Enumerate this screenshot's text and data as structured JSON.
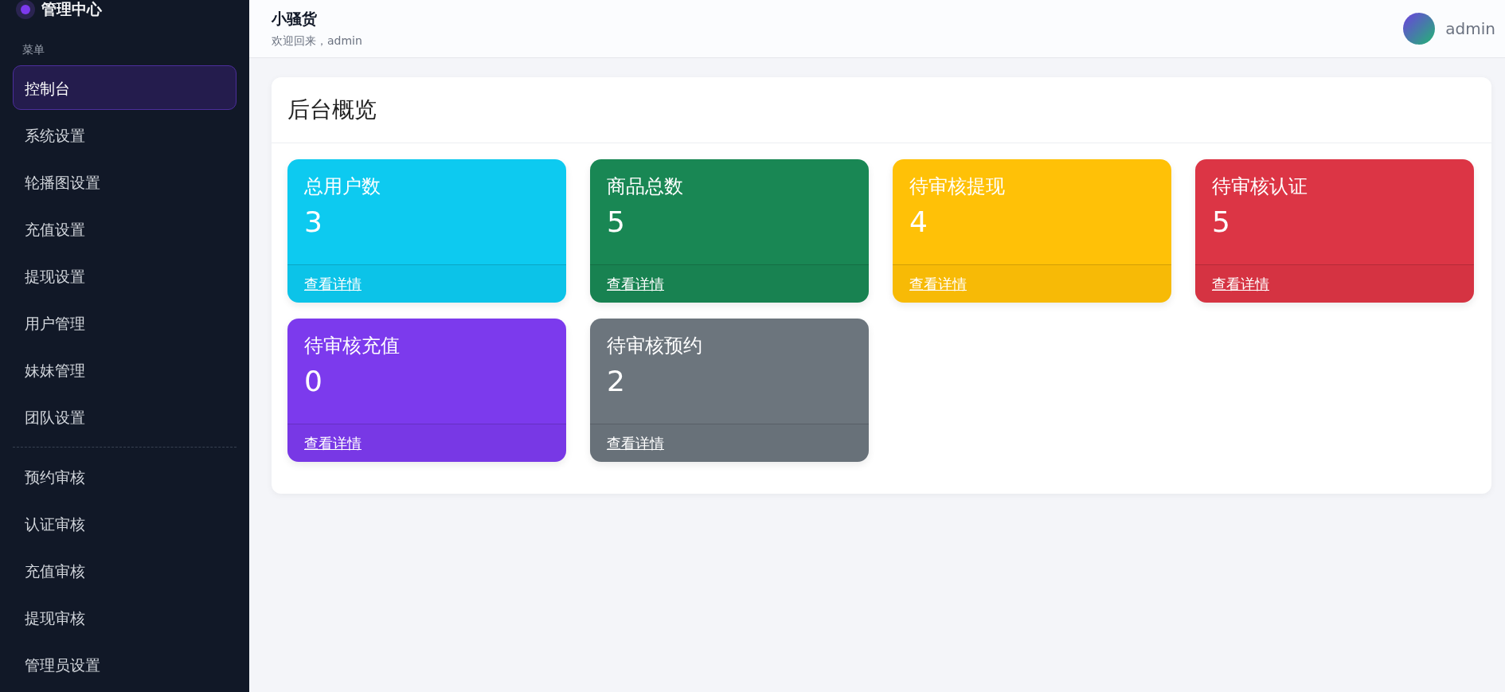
{
  "sidebar": {
    "brand": "管理中心",
    "section_label": "菜单",
    "groups": [
      [
        {
          "label": "控制台",
          "selected": true
        },
        {
          "label": "系统设置",
          "selected": false
        },
        {
          "label": "轮播图设置",
          "selected": false
        },
        {
          "label": "充值设置",
          "selected": false
        },
        {
          "label": "提现设置",
          "selected": false
        },
        {
          "label": "用户管理",
          "selected": false
        },
        {
          "label": "妹妹管理",
          "selected": false
        },
        {
          "label": "团队设置",
          "selected": false
        }
      ],
      [
        {
          "label": "预约审核",
          "selected": false
        },
        {
          "label": "认证审核",
          "selected": false
        },
        {
          "label": "充值审核",
          "selected": false
        },
        {
          "label": "提现审核",
          "selected": false
        },
        {
          "label": "管理员设置",
          "selected": false
        }
      ]
    ]
  },
  "header": {
    "title": "小骚货",
    "subtitle": "欢迎回来，admin",
    "user": "admin"
  },
  "panel": {
    "title": "后台概览",
    "cards": [
      {
        "title": "总用户数",
        "value": "3",
        "link": "查看详情",
        "color": "#0dcaf0"
      },
      {
        "title": "商品总数",
        "value": "5",
        "link": "查看详情",
        "color": "#198754"
      },
      {
        "title": "待审核提现",
        "value": "4",
        "link": "查看详情",
        "color": "#ffc107"
      },
      {
        "title": "待审核认证",
        "value": "5",
        "link": "查看详情",
        "color": "#dc3545"
      },
      {
        "title": "待审核充值",
        "value": "0",
        "link": "查看详情",
        "color": "#7c3aed"
      },
      {
        "title": "待审核预约",
        "value": "2",
        "link": "查看详情",
        "color": "#6c757d"
      }
    ]
  }
}
